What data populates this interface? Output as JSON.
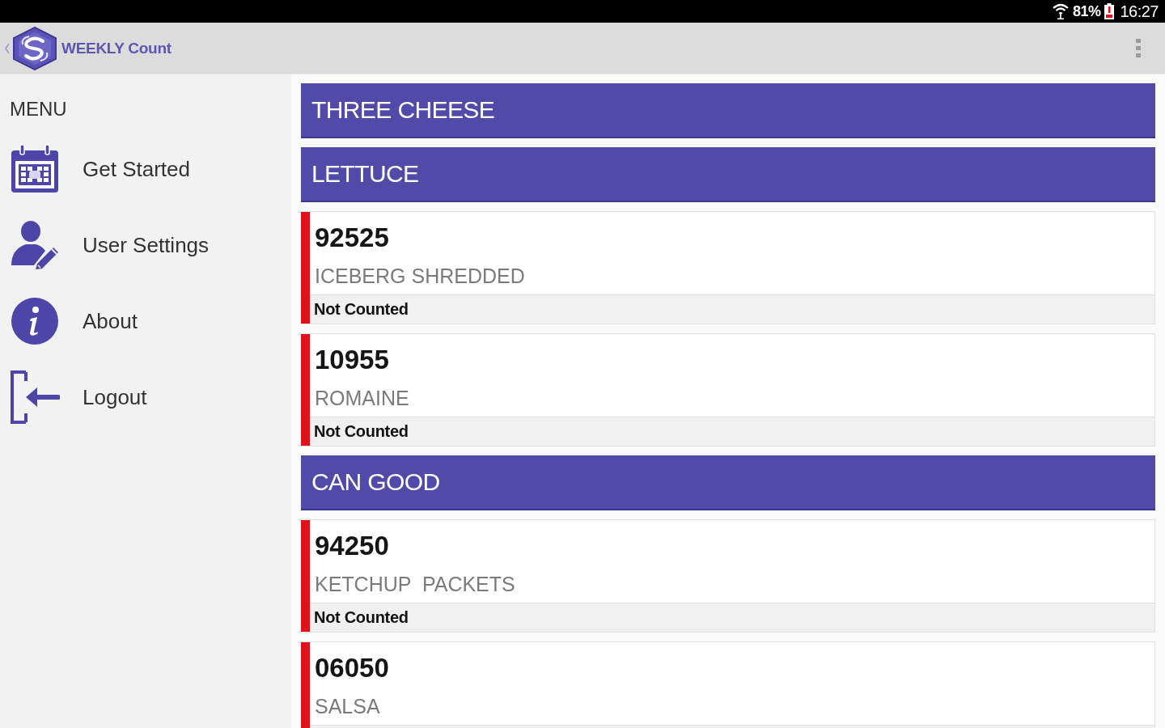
{
  "status_bar": {
    "battery": "81%",
    "time": "16:27"
  },
  "app_bar": {
    "title": "WEEKLY Count"
  },
  "sidebar": {
    "heading": "MENU",
    "items": [
      {
        "kind": "calendar",
        "label": "Get Started"
      },
      {
        "kind": "user",
        "label": "User Settings"
      },
      {
        "kind": "info",
        "label": "About"
      },
      {
        "kind": "logout",
        "label": "Logout"
      }
    ]
  },
  "content": {
    "groups": [
      {
        "title": "THREE CHEESE"
      },
      {
        "title": "LETTUCE",
        "items": [
          {
            "code": "92525",
            "name": "ICEBERG SHREDDED",
            "status": "Not Counted",
            "counted": false
          },
          {
            "code": "10955",
            "name": "ROMAINE",
            "status": "Not Counted",
            "counted": false
          }
        ]
      },
      {
        "title": "CAN GOOD",
        "items": [
          {
            "code": "94250",
            "name": "KETCHUP  PACKETS",
            "status": "Not Counted",
            "counted": false
          },
          {
            "code": "06050",
            "name": "SALSA",
            "counted": false
          }
        ]
      }
    ]
  }
}
